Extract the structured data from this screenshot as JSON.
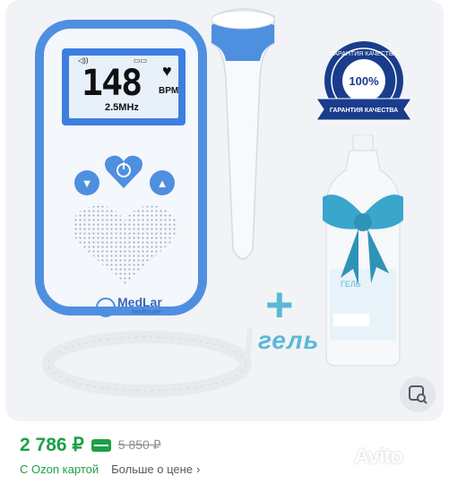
{
  "product": {
    "device_display": {
      "bpm": "148",
      "unit": "BPM",
      "frequency": "2.5MHz"
    },
    "brand_logo": {
      "name": "MedLar",
      "sub": "healthcare"
    },
    "badge": {
      "top_text": "ГАРАНТИЯ КАЧЕСТВА",
      "center": "100%",
      "ribbon": "ГАРАНТИЯ КАЧЕСТВА"
    },
    "bottle_label": "ГЕЛЬ",
    "gel_caption": "гель"
  },
  "pricing": {
    "price": "2 786 ₽",
    "old_price": "5 850 ₽",
    "ozon_card_text": "С Ozon картой",
    "more_price_text": "Больше о цене",
    "chevron": "›"
  },
  "watermark": "Avito",
  "colors": {
    "green": "#1e9f48",
    "device_blue": "#4f8fe0",
    "gel_blue": "#5bb8d8",
    "badge_blue": "#1a3c8c"
  },
  "icons": {
    "lens_button": "image-search-icon",
    "price_card": "card-icon"
  }
}
